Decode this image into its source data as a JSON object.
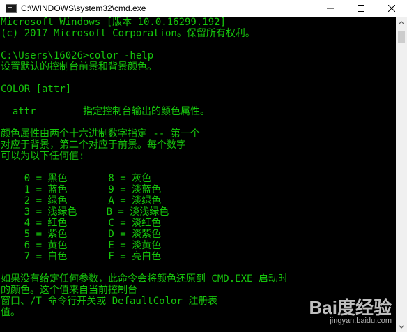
{
  "window": {
    "title": "C:\\WINDOWS\\system32\\cmd.exe",
    "icon": "console-icon",
    "controls": {
      "minimize": "─",
      "maximize": "□",
      "close": "✕"
    }
  },
  "console": {
    "text_color": "#16c60c",
    "background": "#000000",
    "lines": [
      "Microsoft Windows [版本 10.0.16299.192]",
      "(c) 2017 Microsoft Corporation。保留所有权利。",
      "",
      "C:\\Users\\16026>color -help",
      "设置默认的控制台前景和背景颜色。",
      "",
      "COLOR [attr]",
      "",
      "  attr        指定控制台输出的颜色属性。",
      "",
      "颜色属性由两个十六进制数字指定 -- 第一个",
      "对应于背景，第二个对应于前景。每个数字",
      "可以为以下任何值:",
      "",
      "    0 = 黑色       8 = 灰色",
      "    1 = 蓝色       9 = 淡蓝色",
      "    2 = 绿色       A = 淡绿色",
      "    3 = 浅绿色     B = 淡浅绿色",
      "    4 = 红色       C = 淡红色",
      "    5 = 紫色       D = 淡紫色",
      "    6 = 黄色       E = 淡黄色",
      "    7 = 白色       F = 亮白色",
      "",
      "如果没有给定任何参数，此命令会将颜色还原到 CMD.EXE 启动时",
      "的颜色。这个值来自当前控制台",
      "窗口、/T 命令行开关或 DefaultColor 注册表",
      "值。"
    ]
  },
  "scrollbar": {
    "up_arrow": "▲",
    "down_arrow": "▼"
  },
  "watermark": {
    "logo": "Bai度经验",
    "url": "jingyan.baidu.com"
  }
}
